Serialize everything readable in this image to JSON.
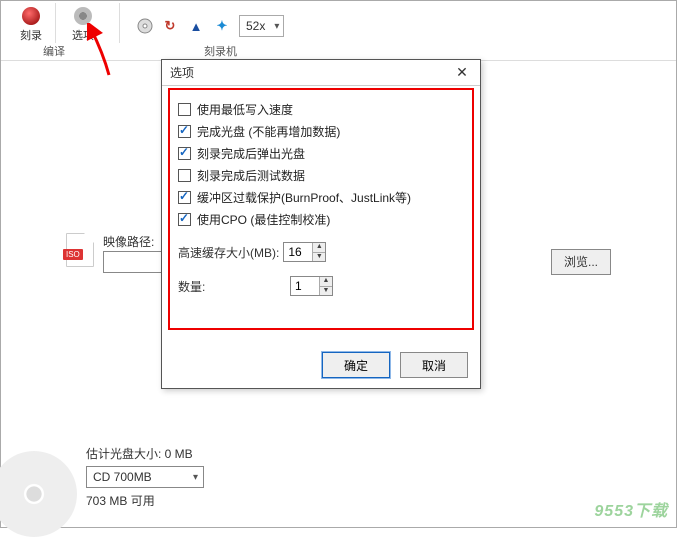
{
  "toolbar": {
    "burn_label": "刻录",
    "options_label": "选项",
    "compile_label": "编译",
    "burner_label": "刻录机",
    "speed_value": "52x"
  },
  "path": {
    "label": "映像路径:",
    "iso_badge": "ISO",
    "input_value": "",
    "browse_label": "浏览..."
  },
  "disc": {
    "size_label": "估计光盘大小: 0 MB",
    "media_option": "CD 700MB",
    "available": "703 MB 可用"
  },
  "dialog": {
    "title": "选项",
    "checkboxes": [
      {
        "label": "使用最低写入速度",
        "checked": false
      },
      {
        "label": "完成光盘 (不能再增加数据)",
        "checked": true
      },
      {
        "label": "刻录完成后弹出光盘",
        "checked": true
      },
      {
        "label": "刻录完成后测试数据",
        "checked": false
      },
      {
        "label": "缓冲区过载保护(BurnProof、JustLink等)",
        "checked": true
      },
      {
        "label": "使用CPO (最佳控制校准)",
        "checked": true
      }
    ],
    "cache_label": "高速缓存大小(MB):",
    "cache_value": "16",
    "qty_label": "数量:",
    "qty_value": "1",
    "ok_label": "确定",
    "cancel_label": "取消"
  },
  "watermark": "9553下载"
}
